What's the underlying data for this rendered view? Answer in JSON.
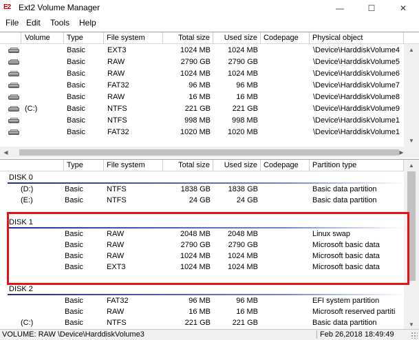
{
  "window": {
    "title": "Ext2 Volume Manager",
    "icon_text": "E2",
    "minimize_glyph": "—",
    "maximize_glyph": "☐",
    "close_glyph": "✕"
  },
  "menu": [
    "File",
    "Edit",
    "Tools",
    "Help"
  ],
  "volumes_table": {
    "columns": [
      "Volume",
      "Type",
      "File system",
      "Total size",
      "Used size",
      "Codepage",
      "Physical object"
    ],
    "rows": [
      {
        "volume": "",
        "type": "Basic",
        "fs": "EXT3",
        "total": "1024 MB",
        "used": "1024 MB",
        "codepage": "",
        "physical": "\\Device\\HarddiskVolume4"
      },
      {
        "volume": "",
        "type": "Basic",
        "fs": "RAW",
        "total": "2790 GB",
        "used": "2790 GB",
        "codepage": "",
        "physical": "\\Device\\HarddiskVolume5"
      },
      {
        "volume": "",
        "type": "Basic",
        "fs": "RAW",
        "total": "1024 MB",
        "used": "1024 MB",
        "codepage": "",
        "physical": "\\Device\\HarddiskVolume6"
      },
      {
        "volume": "",
        "type": "Basic",
        "fs": "FAT32",
        "total": "96 MB",
        "used": "96 MB",
        "codepage": "",
        "physical": "\\Device\\HarddiskVolume7"
      },
      {
        "volume": "",
        "type": "Basic",
        "fs": "RAW",
        "total": "16 MB",
        "used": "16 MB",
        "codepage": "",
        "physical": "\\Device\\HarddiskVolume8"
      },
      {
        "volume": "(C:)",
        "type": "Basic",
        "fs": "NTFS",
        "total": "221 GB",
        "used": "221 GB",
        "codepage": "",
        "physical": "\\Device\\HarddiskVolume9"
      },
      {
        "volume": "",
        "type": "Basic",
        "fs": "NTFS",
        "total": "998 MB",
        "used": "998 MB",
        "codepage": "",
        "physical": "\\Device\\HarddiskVolume1"
      },
      {
        "volume": "",
        "type": "Basic",
        "fs": "FAT32",
        "total": "1020 MB",
        "used": "1020 MB",
        "codepage": "",
        "physical": "\\Device\\HarddiskVolume1"
      }
    ]
  },
  "disks_table": {
    "columns": [
      "",
      "Type",
      "File system",
      "Total size",
      "Used size",
      "Codepage",
      "Partition type"
    ],
    "disks": [
      {
        "label": "DISK 0",
        "partitions": [
          {
            "volume": "(D:)",
            "type": "Basic",
            "fs": "NTFS",
            "total": "1838 GB",
            "used": "1838 GB",
            "ptype": "Basic data partition"
          },
          {
            "volume": "(E:)",
            "type": "Basic",
            "fs": "NTFS",
            "total": "24 GB",
            "used": "24 GB",
            "ptype": "Basic data partition"
          }
        ]
      },
      {
        "label": "DISK 1",
        "partitions": [
          {
            "volume": "",
            "type": "Basic",
            "fs": "RAW",
            "total": "2048 MB",
            "used": "2048 MB",
            "ptype": "Linux swap"
          },
          {
            "volume": "",
            "type": "Basic",
            "fs": "RAW",
            "total": "2790 GB",
            "used": "2790 GB",
            "ptype": "Microsoft basic data"
          },
          {
            "volume": "",
            "type": "Basic",
            "fs": "RAW",
            "total": "1024 MB",
            "used": "1024 MB",
            "ptype": "Microsoft basic data"
          },
          {
            "volume": "",
            "type": "Basic",
            "fs": "EXT3",
            "total": "1024 MB",
            "used": "1024 MB",
            "ptype": "Microsoft basic data"
          }
        ]
      },
      {
        "label": "DISK 2",
        "partitions": [
          {
            "volume": "",
            "type": "Basic",
            "fs": "FAT32",
            "total": "96 MB",
            "used": "96 MB",
            "ptype": "EFI system partition"
          },
          {
            "volume": "",
            "type": "Basic",
            "fs": "RAW",
            "total": "16 MB",
            "used": "16 MB",
            "ptype": "Microsoft reserved partiti"
          },
          {
            "volume": "(C:)",
            "type": "Basic",
            "fs": "NTFS",
            "total": "221 GB",
            "used": "221 GB",
            "ptype": "Basic data partition"
          }
        ]
      }
    ]
  },
  "status": {
    "left": "VOLUME:  RAW \\Device\\HarddiskVolume3",
    "right": "Feb 26,2018 18:49:49"
  },
  "colors": {
    "highlight": "#e8101a",
    "disk_line": "#1a2f8f"
  }
}
